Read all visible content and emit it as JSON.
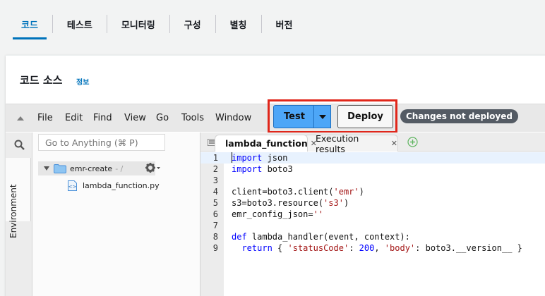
{
  "tabs": [
    {
      "label": "코드",
      "active": true
    },
    {
      "label": "테스트",
      "active": false
    },
    {
      "label": "모니터링",
      "active": false
    },
    {
      "label": "구성",
      "active": false
    },
    {
      "label": "별칭",
      "active": false
    },
    {
      "label": "버전",
      "active": false
    }
  ],
  "panel": {
    "title": "코드 소스",
    "info": "정보"
  },
  "menu": [
    "File",
    "Edit",
    "Find",
    "View",
    "Go",
    "Tools",
    "Window"
  ],
  "toolbar": {
    "test_label": "Test",
    "deploy_label": "Deploy",
    "status": "Changes not deployed"
  },
  "colors": {
    "accent": "#0073bb",
    "test_button": "#4da6f7",
    "highlight_border": "#e0261a",
    "status_bg": "#545b64"
  },
  "sidebar": {
    "env_label": "Environment",
    "search_placeholder": "Go to Anything (⌘ P)"
  },
  "tree": {
    "folder": "emr-create",
    "folder_path": "- /",
    "file": "lambda_function.py"
  },
  "editor_tabs": [
    {
      "label": "lambda_function",
      "active": true
    },
    {
      "label": "Execution results",
      "active": false
    }
  ],
  "code_lines": [
    "import json",
    "import boto3",
    "",
    "client=boto3.client('emr')",
    "s3=boto3.resource('s3')",
    "emr_config_json=''",
    "",
    "def lambda_handler(event, context):",
    "  return { 'statusCode': 200, 'body': boto3.__version__ }"
  ],
  "line_numbers": [
    "1",
    "2",
    "3",
    "4",
    "5",
    "6",
    "7",
    "8",
    "9"
  ]
}
